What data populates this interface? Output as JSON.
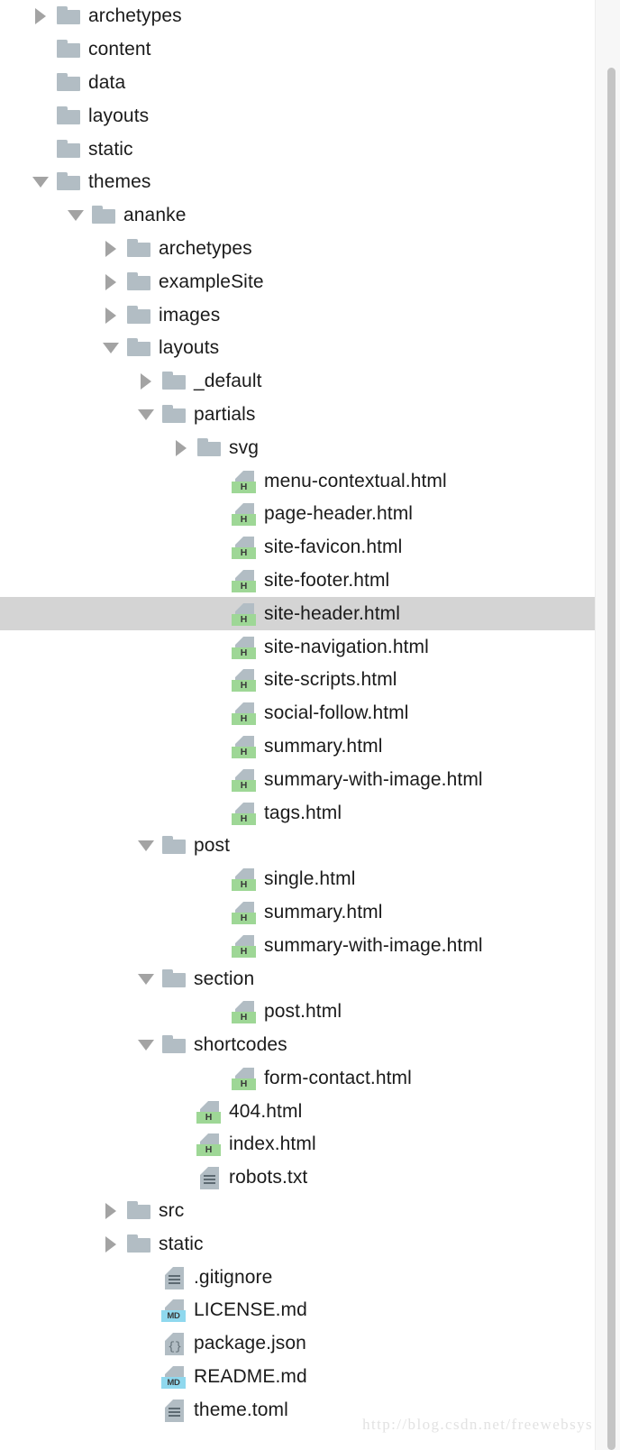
{
  "window": {
    "kind": "file-tree-explorer",
    "watermark": "http://blog.csdn.net/freewebsys",
    "selected_item": "site-header.html",
    "colors": {
      "background": "#ffffff",
      "selection": "#d4d4d4",
      "folder": "#b2bdc4",
      "html_badge": "#9ed796",
      "md_badge": "#8fd8ee",
      "text": "#1b1b1b",
      "twisty": "#a3a3a3",
      "scrollbar_thumb": "#c4c4c4",
      "watermark": "#e2e2e2"
    }
  },
  "scrollbar": {
    "orientation": "vertical",
    "visible": true
  },
  "tree": {
    "items": [
      {
        "label": "archetypes",
        "depth": 1,
        "kind": "folder",
        "twisty": "closed"
      },
      {
        "label": "content",
        "depth": 1,
        "kind": "folder",
        "twisty": "none"
      },
      {
        "label": "data",
        "depth": 1,
        "kind": "folder",
        "twisty": "none"
      },
      {
        "label": "layouts",
        "depth": 1,
        "kind": "folder",
        "twisty": "none"
      },
      {
        "label": "static",
        "depth": 1,
        "kind": "folder",
        "twisty": "none"
      },
      {
        "label": "themes",
        "depth": 1,
        "kind": "folder",
        "twisty": "open"
      },
      {
        "label": "ananke",
        "depth": 2,
        "kind": "folder",
        "twisty": "open"
      },
      {
        "label": "archetypes",
        "depth": 3,
        "kind": "folder",
        "twisty": "closed"
      },
      {
        "label": "exampleSite",
        "depth": 3,
        "kind": "folder",
        "twisty": "closed"
      },
      {
        "label": "images",
        "depth": 3,
        "kind": "folder",
        "twisty": "closed"
      },
      {
        "label": "layouts",
        "depth": 3,
        "kind": "folder",
        "twisty": "open"
      },
      {
        "label": "_default",
        "depth": 4,
        "kind": "folder",
        "twisty": "closed"
      },
      {
        "label": "partials",
        "depth": 4,
        "kind": "folder",
        "twisty": "open"
      },
      {
        "label": "svg",
        "depth": 5,
        "kind": "folder",
        "twisty": "closed"
      },
      {
        "label": "menu-contextual.html",
        "depth": 6,
        "kind": "html",
        "twisty": "none"
      },
      {
        "label": "page-header.html",
        "depth": 6,
        "kind": "html",
        "twisty": "none"
      },
      {
        "label": "site-favicon.html",
        "depth": 6,
        "kind": "html",
        "twisty": "none"
      },
      {
        "label": "site-footer.html",
        "depth": 6,
        "kind": "html",
        "twisty": "none"
      },
      {
        "label": "site-header.html",
        "depth": 6,
        "kind": "html",
        "twisty": "none",
        "selected": true
      },
      {
        "label": "site-navigation.html",
        "depth": 6,
        "kind": "html",
        "twisty": "none"
      },
      {
        "label": "site-scripts.html",
        "depth": 6,
        "kind": "html",
        "twisty": "none"
      },
      {
        "label": "social-follow.html",
        "depth": 6,
        "kind": "html",
        "twisty": "none"
      },
      {
        "label": "summary.html",
        "depth": 6,
        "kind": "html",
        "twisty": "none"
      },
      {
        "label": "summary-with-image.html",
        "depth": 6,
        "kind": "html",
        "twisty": "none"
      },
      {
        "label": "tags.html",
        "depth": 6,
        "kind": "html",
        "twisty": "none"
      },
      {
        "label": "post",
        "depth": 4,
        "kind": "folder",
        "twisty": "open"
      },
      {
        "label": "single.html",
        "depth": 6,
        "kind": "html",
        "twisty": "none"
      },
      {
        "label": "summary.html",
        "depth": 6,
        "kind": "html",
        "twisty": "none"
      },
      {
        "label": "summary-with-image.html",
        "depth": 6,
        "kind": "html",
        "twisty": "none"
      },
      {
        "label": "section",
        "depth": 4,
        "kind": "folder",
        "twisty": "open"
      },
      {
        "label": "post.html",
        "depth": 6,
        "kind": "html",
        "twisty": "none"
      },
      {
        "label": "shortcodes",
        "depth": 4,
        "kind": "folder",
        "twisty": "open"
      },
      {
        "label": "form-contact.html",
        "depth": 6,
        "kind": "html",
        "twisty": "none"
      },
      {
        "label": "404.html",
        "depth": 5,
        "kind": "html",
        "twisty": "none"
      },
      {
        "label": "index.html",
        "depth": 5,
        "kind": "html",
        "twisty": "none"
      },
      {
        "label": "robots.txt",
        "depth": 5,
        "kind": "text",
        "twisty": "none"
      },
      {
        "label": "src",
        "depth": 3,
        "kind": "folder",
        "twisty": "closed"
      },
      {
        "label": "static",
        "depth": 3,
        "kind": "folder",
        "twisty": "closed"
      },
      {
        "label": ".gitignore",
        "depth": 4,
        "kind": "text",
        "twisty": "none"
      },
      {
        "label": "LICENSE.md",
        "depth": 4,
        "kind": "md",
        "twisty": "none"
      },
      {
        "label": "package.json",
        "depth": 4,
        "kind": "json",
        "twisty": "none"
      },
      {
        "label": "README.md",
        "depth": 4,
        "kind": "md",
        "twisty": "none"
      },
      {
        "label": "theme.toml",
        "depth": 4,
        "kind": "text",
        "twisty": "none"
      }
    ],
    "badge_labels": {
      "html": "H",
      "md": "MD",
      "json": "{}"
    }
  }
}
